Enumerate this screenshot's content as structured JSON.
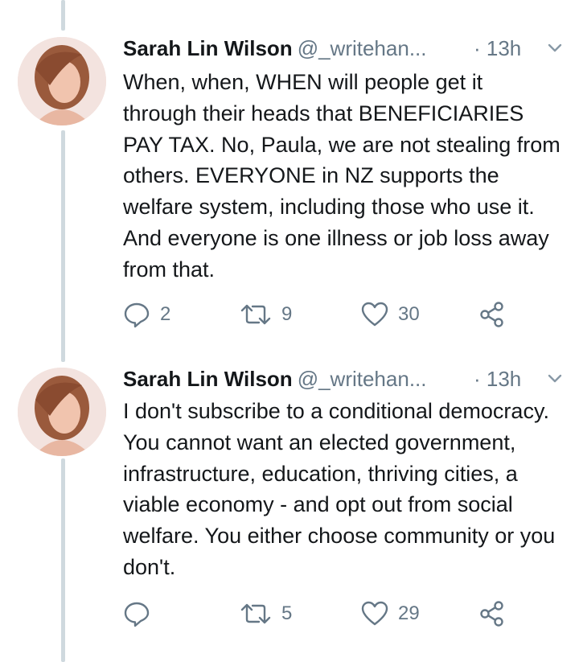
{
  "tweets": [
    {
      "name": "Sarah Lin Wilson",
      "handle": "@_writehan...",
      "time": "· 13h",
      "text": "When, when, WHEN will people get it through their heads that BENEFICIARIES PAY TAX. No, Paula, we are not stealing from others. EVERYONE in NZ supports the welfare system, including those who use it. And everyone is one illness or job loss away from that.",
      "replies": "2",
      "retweets": "9",
      "likes": "30"
    },
    {
      "name": "Sarah Lin Wilson",
      "handle": "@_writehan...",
      "time": "· 13h",
      "text": "I don't subscribe to a conditional democracy. You cannot want an elected government, infrastructure, education, thriving cities, a viable economy - and opt out from social welfare. You either choose community or you don't.",
      "replies": "",
      "retweets": "5",
      "likes": "29"
    }
  ],
  "icons": {
    "reply": "reply-icon",
    "retweet": "retweet-icon",
    "like": "heart-icon",
    "share": "share-icon",
    "menu": "chevron-down-icon"
  },
  "colors": {
    "text": "#14171a",
    "secondary": "#657786",
    "thread_line": "#cfd9de"
  }
}
